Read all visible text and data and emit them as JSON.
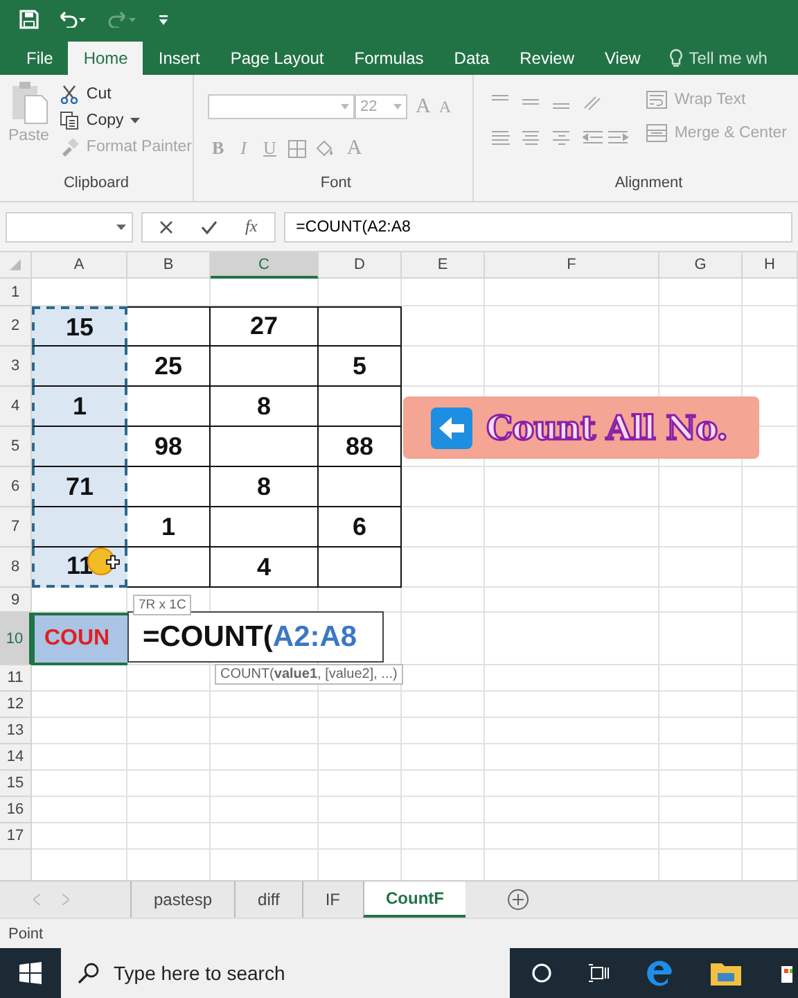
{
  "quick_access": [
    {
      "kind": "save",
      "disabled": false
    },
    {
      "kind": "undo",
      "disabled": false
    },
    {
      "kind": "redo",
      "disabled": true
    },
    {
      "kind": "customize",
      "disabled": false
    }
  ],
  "tabs": [
    {
      "label": "File",
      "selected": false
    },
    {
      "label": "Home",
      "selected": true
    },
    {
      "label": "Insert",
      "selected": false
    },
    {
      "label": "Page Layout",
      "selected": false
    },
    {
      "label": "Formulas",
      "selected": false
    },
    {
      "label": "Data",
      "selected": false
    },
    {
      "label": "Review",
      "selected": false
    },
    {
      "label": "View",
      "selected": false
    }
  ],
  "tell_me": {
    "label": "Tell me wh"
  },
  "ribbon": {
    "clipboard": {
      "title": "Clipboard",
      "paste": {
        "label": "Paste",
        "disabled": true
      },
      "commands": [
        {
          "label": "Cut",
          "kind": "cut",
          "disabled": false
        },
        {
          "label": "Copy",
          "kind": "copy",
          "disabled": false
        },
        {
          "label": "Format Painter",
          "kind": "painter",
          "disabled": true
        }
      ]
    },
    "font": {
      "title": "Font",
      "size": "22",
      "disabled": true,
      "size_buttons": [
        "A",
        "A"
      ],
      "style_buttons": [
        "B",
        "I",
        "U"
      ],
      "color_button": "A"
    },
    "alignment": {
      "title": "Alignment",
      "commands": [
        {
          "label": "Wrap Text",
          "kind": "wrap",
          "disabled": true
        },
        {
          "label": "Merge & Center",
          "kind": "merge",
          "disabled": true
        }
      ]
    }
  },
  "formula_bar": {
    "function_label": "fx",
    "formula": "=COUNT(A2:A8"
  },
  "sheet": {
    "columns": [
      {
        "label": "A",
        "selected": false
      },
      {
        "label": "B",
        "selected": false
      },
      {
        "label": "C",
        "selected": true
      },
      {
        "label": "D",
        "selected": false
      },
      {
        "label": "E",
        "selected": false
      },
      {
        "label": "F",
        "selected": false
      },
      {
        "label": "G",
        "selected": false
      },
      {
        "label": "H",
        "selected": false
      }
    ],
    "rows": [
      {
        "label": "1",
        "selected": false,
        "in_reference": false,
        "table": false,
        "cells": []
      },
      {
        "label": "2",
        "selected": false,
        "in_reference": true,
        "table": true,
        "cells": {
          "A": "15",
          "C": "27"
        }
      },
      {
        "label": "3",
        "selected": false,
        "in_reference": true,
        "table": true,
        "cells": {
          "B": "25",
          "D": "5"
        }
      },
      {
        "label": "4",
        "selected": false,
        "in_reference": true,
        "table": true,
        "cells": {
          "A": "1",
          "C": "8"
        }
      },
      {
        "label": "5",
        "selected": false,
        "in_reference": true,
        "table": true,
        "cells": {
          "B": "98",
          "D": "88"
        }
      },
      {
        "label": "6",
        "selected": false,
        "in_reference": true,
        "table": true,
        "cells": {
          "A": "71",
          "C": "8"
        }
      },
      {
        "label": "7",
        "selected": false,
        "in_reference": true,
        "table": true,
        "cells": {
          "B": "1",
          "D": "6"
        }
      },
      {
        "label": "8",
        "selected": false,
        "in_reference": true,
        "table": true,
        "cells": {
          "A": "11",
          "C": "4"
        }
      },
      {
        "label": "9",
        "selected": false,
        "in_reference": false,
        "table": false,
        "cells": []
      },
      {
        "label": "10",
        "selected": true,
        "in_reference": false,
        "table": false,
        "cells": {
          "A": "COUN"
        },
        "function_name_cell": true
      },
      {
        "label": "11",
        "selected": false,
        "in_reference": false,
        "table": false,
        "cells": []
      },
      {
        "label": "12",
        "selected": false,
        "in_reference": false,
        "table": false,
        "cells": []
      },
      {
        "label": "13",
        "selected": false,
        "in_reference": false,
        "table": false,
        "cells": []
      },
      {
        "label": "14",
        "selected": false,
        "in_reference": false,
        "table": false,
        "cells": []
      },
      {
        "label": "15",
        "selected": false,
        "in_reference": false,
        "table": false,
        "cells": []
      },
      {
        "label": "16",
        "selected": false,
        "in_reference": false,
        "table": false,
        "cells": []
      },
      {
        "label": "17",
        "selected": false,
        "in_reference": false,
        "table": false,
        "cells": []
      }
    ],
    "editor": {
      "parts": [
        {
          "text": "=COUNT(",
          "kind": "function"
        },
        {
          "text": "A2:A8",
          "kind": "reference"
        }
      ]
    },
    "size_tip": "7R x 1C",
    "function_tip": "COUNT(**value1**, [value2], ...)",
    "banner": {
      "text": "Count All No."
    }
  },
  "sheet_tabs": [
    {
      "label": "pastesp",
      "selected": false
    },
    {
      "label": "diff",
      "selected": false
    },
    {
      "label": "IF",
      "selected": false
    },
    {
      "label": "CountF",
      "selected": true
    }
  ],
  "status": "Point",
  "taskbar": {
    "search_placeholder": "Type here to search"
  }
}
